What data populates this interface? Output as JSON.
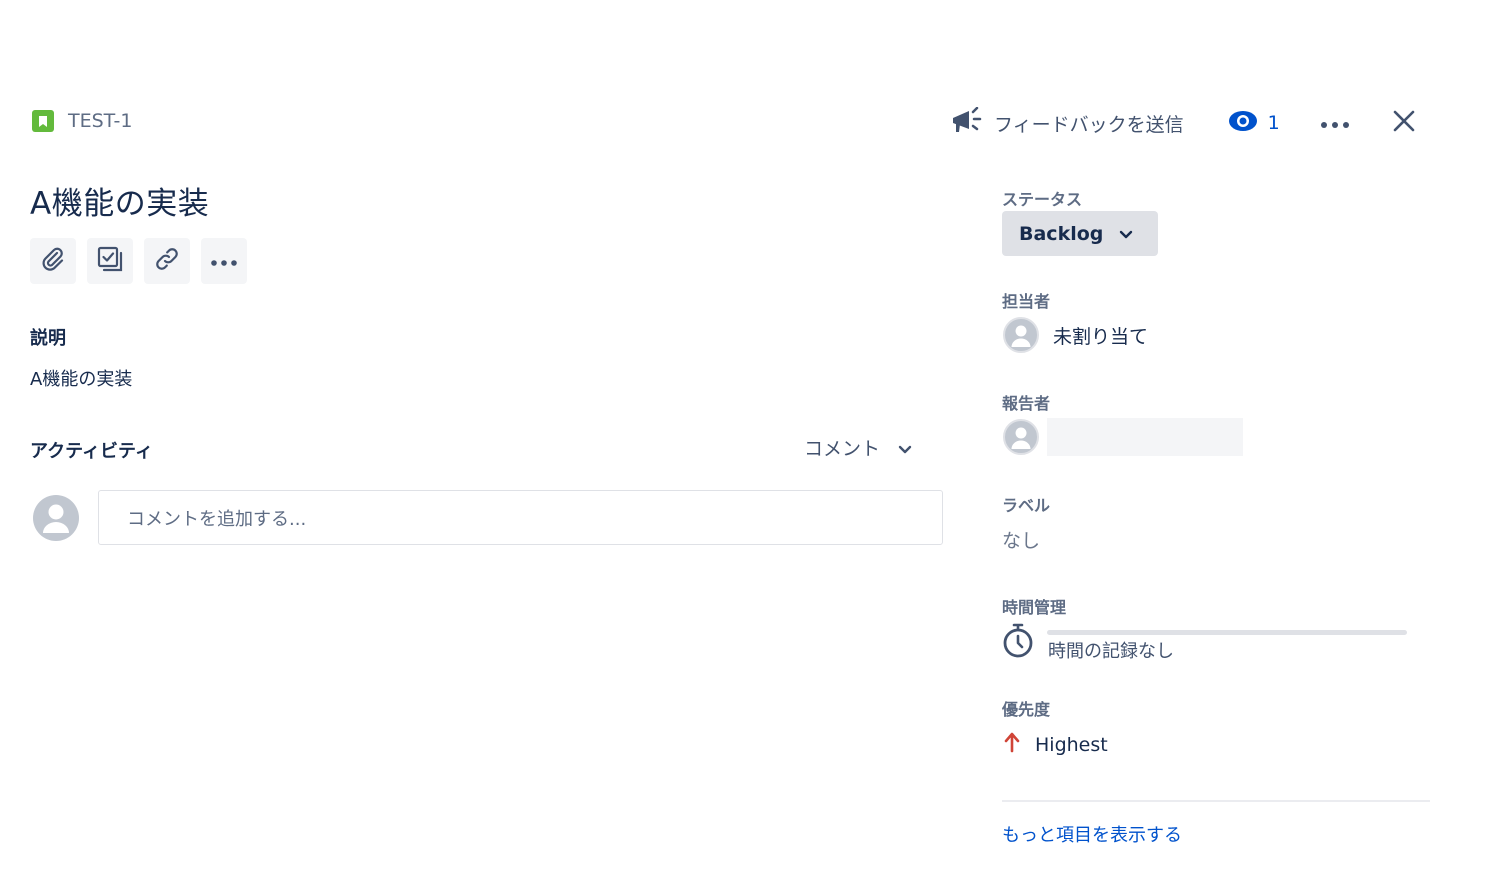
{
  "header": {
    "issue_key": "TEST-1",
    "feedback_label": "フィードバックを送信",
    "watch_count": "1"
  },
  "issue": {
    "summary": "A機能の実装",
    "description_heading": "説明",
    "description_text": "A機能の実装"
  },
  "activity": {
    "heading": "アクティビティ",
    "filter_label": "コメント",
    "comment_placeholder": "コメントを追加する..."
  },
  "sidebar": {
    "status_label": "ステータス",
    "status_value": "Backlog",
    "assignee_label": "担当者",
    "assignee_value": "未割り当て",
    "reporter_label": "報告者",
    "labels_label": "ラベル",
    "labels_value": "なし",
    "time_tracking_label": "時間管理",
    "time_tracking_value": "時間の記録なし",
    "priority_label": "優先度",
    "priority_value": "Highest",
    "show_more_label": "もっと項目を表示する"
  },
  "colors": {
    "issue_type": "#63ba3c",
    "link": "#0052cc",
    "priority_highest": "#d04437"
  }
}
